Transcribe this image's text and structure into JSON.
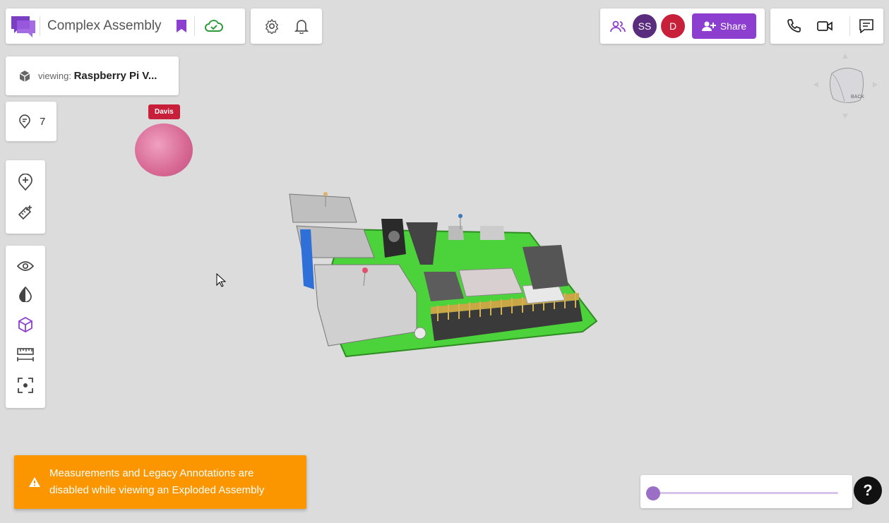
{
  "header": {
    "assembly_title": "Complex Assembly"
  },
  "collaborators": [
    {
      "initials": "SS",
      "color": "#5a2c7e"
    },
    {
      "initials": "D",
      "color": "#c8203b"
    }
  ],
  "share": {
    "label": "Share"
  },
  "viewing": {
    "label": "viewing:",
    "name": "Raspberry Pi V..."
  },
  "annotations": {
    "count": "7"
  },
  "presence": {
    "user_name": "Davis"
  },
  "view_cube": {
    "face_label": "BACK"
  },
  "toast": {
    "message": "Measurements and Legacy Annotations are disabled while viewing an Exploded Assembly"
  },
  "explode_slider": {
    "value": 0
  },
  "help": {
    "label": "?"
  },
  "colors": {
    "accent": "#8c3fcf",
    "cloud_saved": "#2e9b3a",
    "warning": "#fb9600",
    "pcb": "#4cd23a"
  },
  "icons": {
    "header": [
      "logo-icon",
      "bookmark-icon",
      "cloud-check-icon",
      "gear-icon",
      "bell-icon",
      "people-icon",
      "person-add-icon",
      "phone-icon",
      "video-icon",
      "chat-icon"
    ],
    "tools": [
      "add-pin-icon",
      "ruler-add-icon",
      "eye-icon",
      "contrast-icon",
      "cube-icon",
      "measure-icon",
      "focus-icon"
    ]
  }
}
